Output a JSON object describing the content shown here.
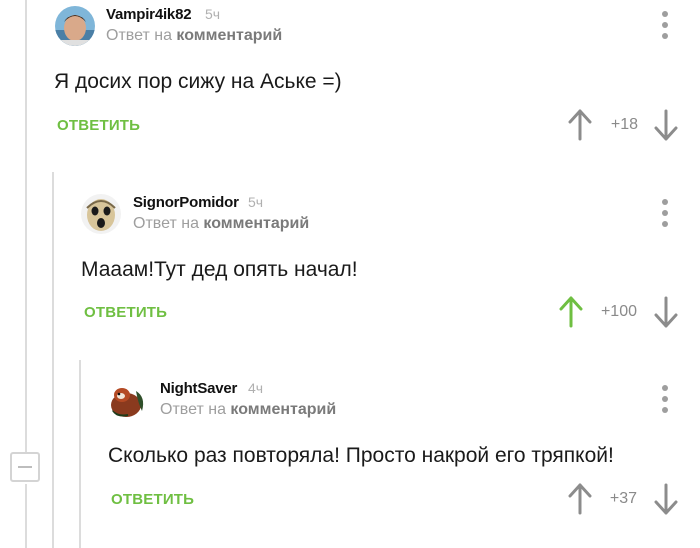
{
  "colors": {
    "accent": "#6fbf42",
    "muted": "#9e9e9e",
    "upvoted": "#6fbf42"
  },
  "comments": [
    {
      "username": "Vampir4ik82",
      "time": "5ч",
      "reply_prefix": "Ответ на",
      "reply_target": "комментарий",
      "text": "Я досих пор сижу на Аське =)",
      "reply_label": "ОТВЕТИТЬ",
      "rating": "+18",
      "upvoted": false
    },
    {
      "username": "SignorPomidor",
      "time": "5ч",
      "reply_prefix": "Ответ на",
      "reply_target": "комментарий",
      "text": "Мааам!Тут дед опять начал!",
      "reply_label": "ОТВЕТИТЬ",
      "rating": "+100",
      "upvoted": true
    },
    {
      "username": "NightSaver",
      "time": "4ч",
      "reply_prefix": "Ответ на",
      "reply_target": "комментарий",
      "text": "Сколько раз повторяла! Просто накрой его тряпкой!",
      "reply_label": "ОТВЕТИТЬ",
      "rating": "+37",
      "upvoted": false
    }
  ],
  "icons": {
    "collapse": "minus-square-icon",
    "more": "more-vertical-icon",
    "up": "arrow-up-icon",
    "down": "arrow-down-icon"
  }
}
